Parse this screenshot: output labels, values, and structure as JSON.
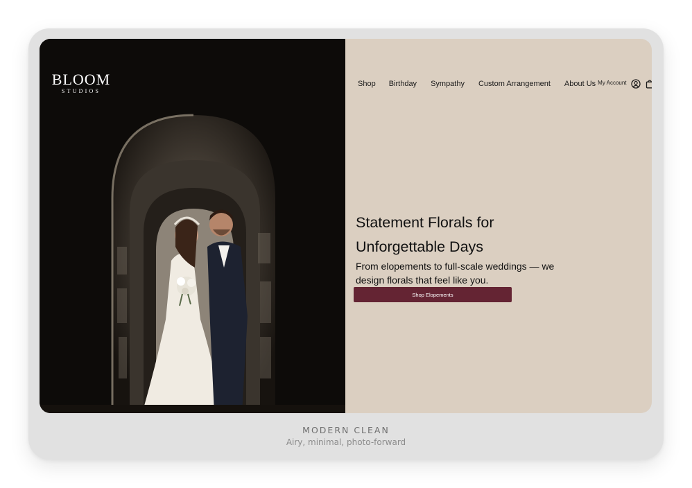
{
  "brand": {
    "name": "BLOOM",
    "tagline": "STUDIOS"
  },
  "nav": {
    "items": [
      "Shop",
      "Birthday",
      "Sympathy",
      "Custom Arrangement",
      "About Us"
    ],
    "account_label": "My Account",
    "icons": [
      "user-circle-icon",
      "shopping-bag-icon"
    ]
  },
  "hero": {
    "title": "Statement Florals for Unforgettable Days",
    "subtitle": "From elopements to full-scale weddings — we design florals that feel like you.",
    "cta_label": "Shop Elopements"
  },
  "caption": {
    "title": "MODERN CLEAN",
    "subtitle": "Airy, minimal, photo-forward"
  },
  "colors": {
    "frame_background": "#e1e1e1",
    "content_background": "#dbcfc1",
    "cta_background": "#642433",
    "text": "#111111"
  }
}
